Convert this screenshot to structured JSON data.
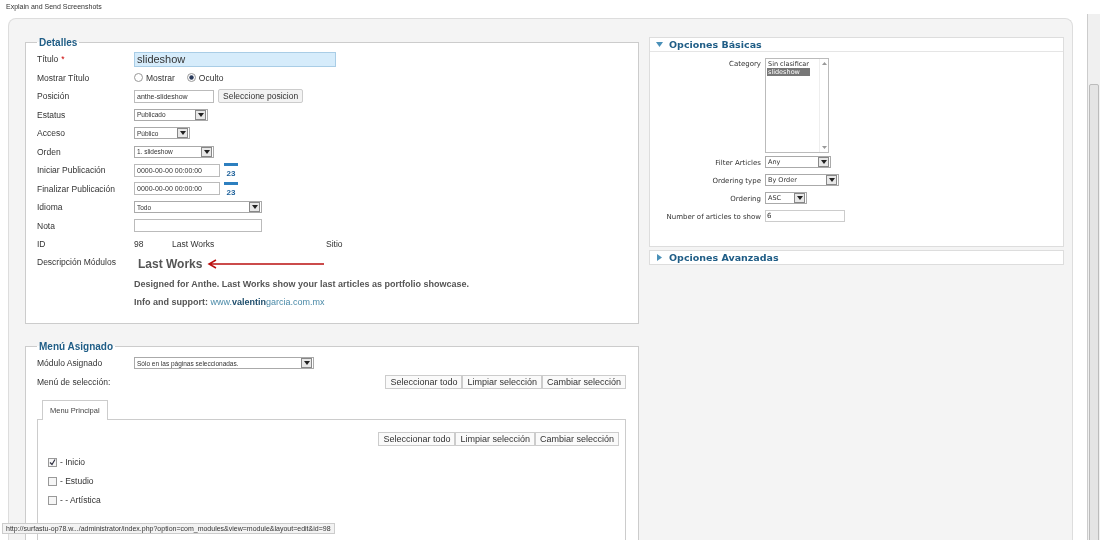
{
  "top_title": "Explain and Send Screenshots",
  "details": {
    "legend": "Detalles",
    "fields": [
      {
        "kind": "text",
        "label": "Título",
        "required": "*",
        "value": "slideshow",
        "focused": true
      },
      {
        "kind": "radio",
        "label": "Mostrar Título",
        "options": [
          {
            "label": "Mostrar",
            "selected": false
          },
          {
            "label": "Oculto",
            "selected": true
          }
        ]
      },
      {
        "kind": "text_button",
        "label": "Posición",
        "value": "anthe-slideshow",
        "button": "Seleccione posicion"
      },
      {
        "kind": "select",
        "label": "Estatus",
        "value": "Publicado"
      },
      {
        "kind": "select",
        "label": "Acceso",
        "value": "Público"
      },
      {
        "kind": "select",
        "label": "Orden",
        "value": "1. slideshow"
      },
      {
        "kind": "date",
        "label": "Iniciar Publicación",
        "value": "0000-00-00 00:00:00",
        "calendar": "23"
      },
      {
        "kind": "date",
        "label": "Finalizar Publicación",
        "value": "0000-00-00 00:00:00",
        "calendar": "23"
      },
      {
        "kind": "select",
        "label": "Idioma",
        "value": "Todo"
      },
      {
        "kind": "text",
        "label": "Nota",
        "focused": false
      },
      {
        "kind": "info",
        "label": "ID",
        "items": [
          "98",
          "Last Works",
          "Sitio"
        ]
      },
      {
        "kind": "description",
        "label": "Descripción Módulos",
        "title": "Last Works",
        "text": "Designed for Anthe. Last Works show your last articles as portfolio showcase.",
        "support": "Info and support:",
        "link": "www.**valentin**garcia.com.mx"
      }
    ]
  },
  "menu": {
    "legend": "Menú Asignado",
    "module_label": "Módulo Asignado",
    "module_value": "Sólo en las páginas seleccionadas.",
    "selection_label": "Menú de selección:",
    "buttons": [
      "Seleccionar todo",
      "Limpiar selección",
      "Cambiar selección"
    ],
    "tabs": [
      {
        "label": "Menu Principal",
        "selected": true
      }
    ],
    "inner_buttons": [
      "Seleccionar todo",
      "Limpiar selección",
      "Cambiar selección"
    ],
    "items": [
      {
        "label": "- Inicio",
        "checked": true
      },
      {
        "label": "- Estudio",
        "checked": false
      },
      {
        "label": "- - Artística",
        "checked": false
      }
    ]
  },
  "basic": {
    "title": "Opciones Básicas",
    "expanded": true,
    "fields": [
      {
        "kind": "listbox",
        "label": "Category",
        "options": [
          {
            "label": "Sin clasificar",
            "selected": false
          },
          {
            "label": "slideshow",
            "selected": true
          }
        ]
      },
      {
        "kind": "select",
        "label": "Filter Articles",
        "value": "Any"
      },
      {
        "kind": "select",
        "label": "Ordering type",
        "value": "By Order"
      },
      {
        "kind": "select",
        "label": "Ordering",
        "value": "ASC"
      },
      {
        "kind": "text",
        "label": "Number of articles to show",
        "value": "6"
      }
    ]
  },
  "advanced": {
    "title": "Opciones Avanzadas",
    "expanded": false
  },
  "status_bar": "http://surfastu-op78.w.../administrator/index.php?option=com_modules&view=module&layout=edit&id=98"
}
